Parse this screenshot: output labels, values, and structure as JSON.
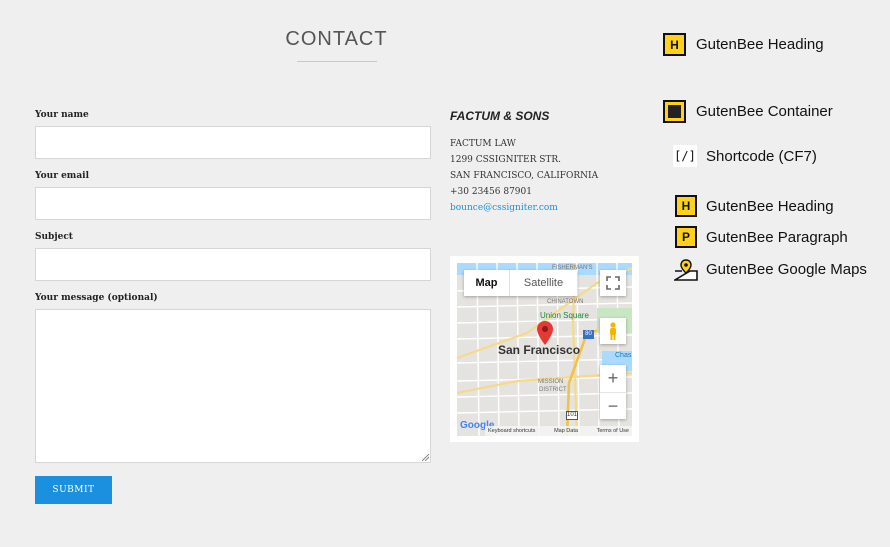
{
  "page": {
    "title": "CONTACT"
  },
  "form": {
    "name_label": "Your name",
    "email_label": "Your email",
    "subject_label": "Subject",
    "message_label": "Your message (optional)",
    "submit_label": "SUBMIT"
  },
  "contact": {
    "company": "FACTUM & SONS",
    "line1": "FACTUM LAW",
    "line2": "1299 CSSIGNITER STR.",
    "line3": "SAN FRANCISCO, CALIFORNIA",
    "phone": "+30 23456 87901",
    "email": "bounce@cssigniter.com"
  },
  "map": {
    "tab_map": "Map",
    "tab_satellite": "Satellite",
    "city_label": "San Francisco",
    "labels": {
      "fishermans": "FISHERMAN'S",
      "chinatown": "CHINATOWN",
      "union_square": "Union Square",
      "mission": "MISSION",
      "district": "DISTRICT",
      "ac": "AC",
      "ch": "Chas",
      "hwy80": "80",
      "hwy101": "101"
    },
    "zoom_in": "+",
    "zoom_out": "−",
    "google": "Google",
    "footer_shortcuts": "Keyboard shortcuts",
    "footer_data": "Map Data",
    "footer_terms": "Terms of Use"
  },
  "legend": {
    "heading_top": "GutenBee Heading",
    "container": "GutenBee Container",
    "shortcode": "Shortcode (CF7)",
    "heading": "GutenBee Heading",
    "paragraph": "GutenBee Paragraph",
    "maps": "GutenBee Google Maps",
    "icon_h": "H",
    "icon_p": "P",
    "icon_shortcode": "[/]",
    "icons": [
      "heading-icon",
      "container-icon",
      "shortcode-icon",
      "heading-icon",
      "paragraph-icon",
      "google-maps-icon"
    ],
    "accent_color": "#ffd11a"
  },
  "colors": {
    "button": "#1b90de",
    "link": "#1b90de",
    "background": "#efefef"
  }
}
